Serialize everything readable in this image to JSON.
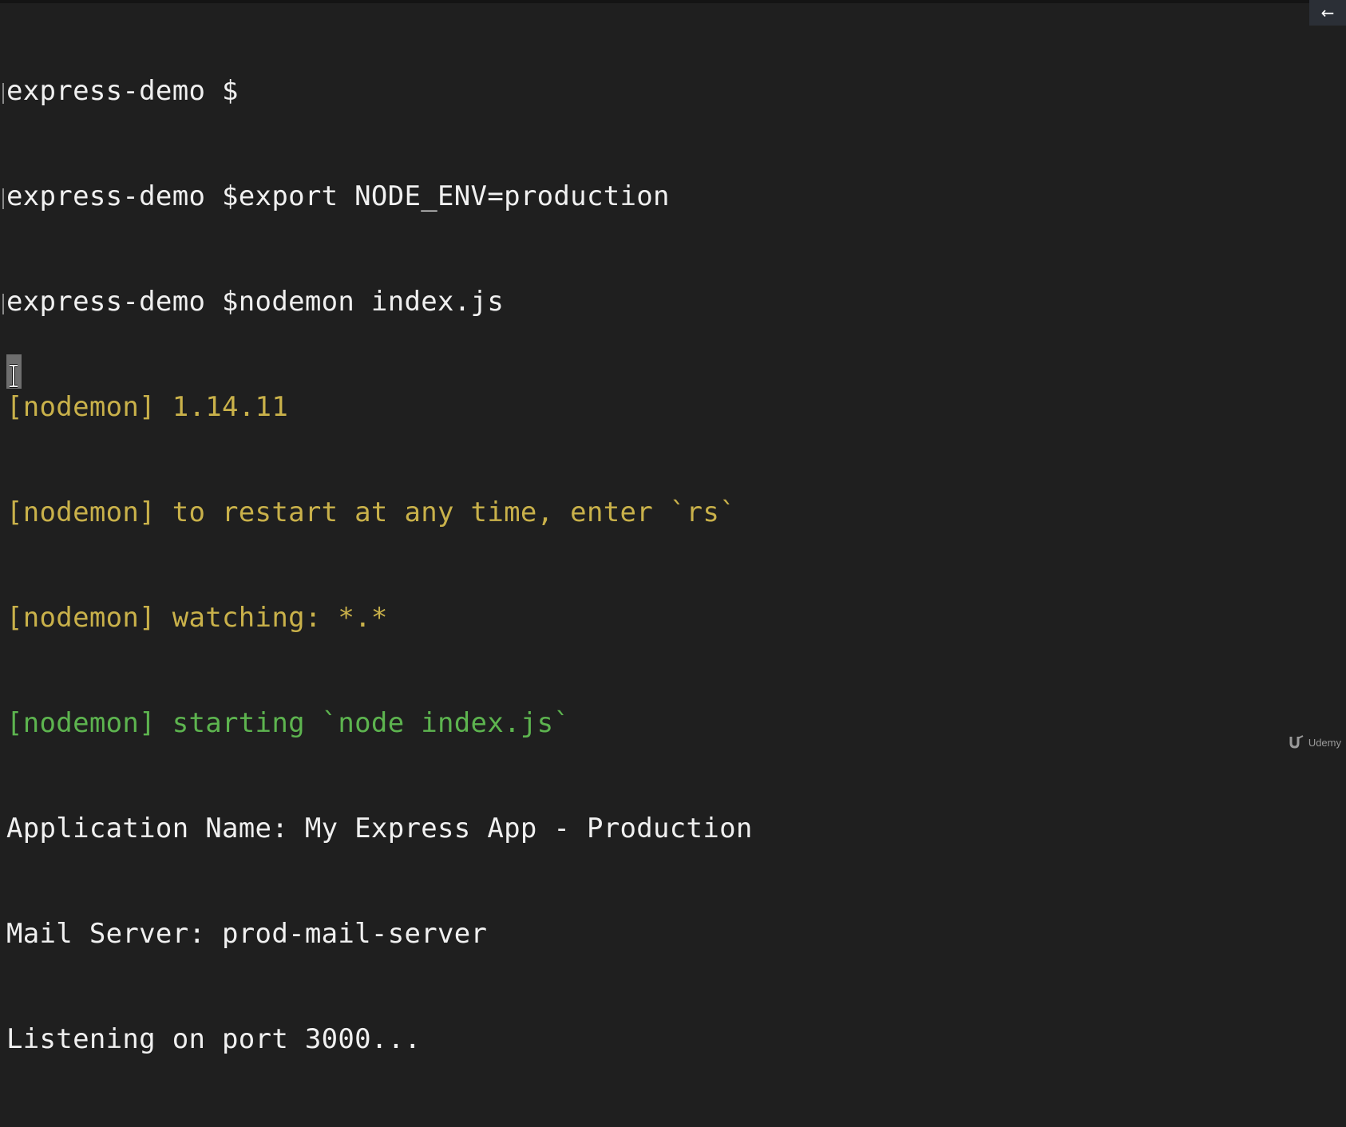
{
  "terminal": {
    "lines": [
      {
        "text": "express-demo $",
        "kind": "prompt"
      },
      {
        "text": "express-demo $export NODE_ENV=production",
        "kind": "prompt"
      },
      {
        "text": "express-demo $nodemon index.js",
        "kind": "prompt"
      },
      {
        "text": "[nodemon] 1.14.11",
        "kind": "nodemon-info"
      },
      {
        "text": "[nodemon] to restart at any time, enter `rs`",
        "kind": "nodemon-info"
      },
      {
        "text": "[nodemon] watching: *.*",
        "kind": "nodemon-info"
      },
      {
        "text": "[nodemon] starting `node index.js`",
        "kind": "nodemon-start"
      },
      {
        "text": "Application Name: My Express App - Production",
        "kind": "app-output"
      },
      {
        "text": "Mail Server: prod-mail-server",
        "kind": "app-output"
      },
      {
        "text": "Listening on port 3000...",
        "kind": "app-output"
      }
    ]
  },
  "back_button": {
    "icon": "arrow-left-icon",
    "glyph": "←"
  },
  "watermark": {
    "brand": "Udemy",
    "icon": "udemy-logo-icon"
  },
  "colors": {
    "background": "#1f1f1f",
    "prompt_text": "#f0f0f0",
    "nodemon_info": "#c9b14a",
    "nodemon_start": "#5db44f",
    "app_output": "#f0f0f0",
    "cursor": "#6e6e6e"
  }
}
